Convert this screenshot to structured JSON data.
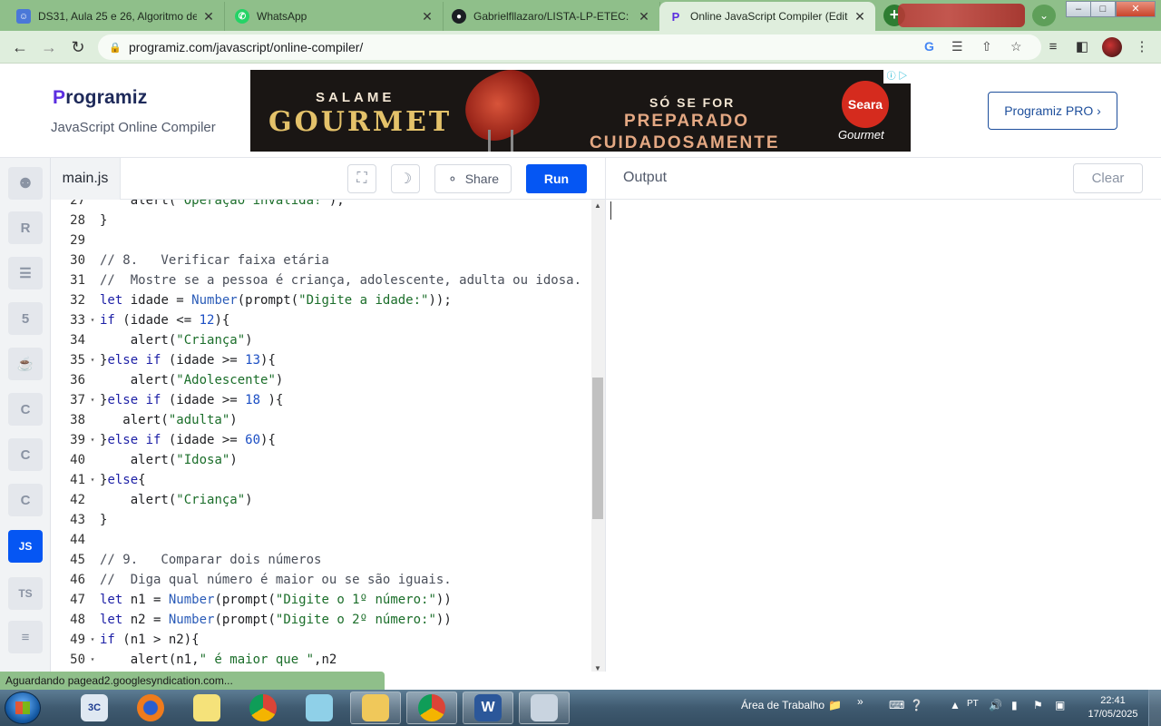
{
  "browser": {
    "tabs": [
      {
        "title": "DS31, Aula 25 e 26, Algoritmo de",
        "icon": "user-doc-icon"
      },
      {
        "title": "WhatsApp",
        "icon": "whatsapp-icon"
      },
      {
        "title": "Gabrielfllazaro/LISTA-LP-ETEC: lis",
        "icon": "github-icon"
      },
      {
        "title": "Online JavaScript Compiler (Edito",
        "icon": "programiz-icon"
      }
    ],
    "url": "programiz.com/javascript/online-compiler/"
  },
  "header": {
    "logo": "rogramiz",
    "logo_p": "P",
    "subtitle": "JavaScript Online Compiler",
    "pro_button": "Programiz PRO ›"
  },
  "ad": {
    "salame": "SALAME",
    "gourmet": "GOURMET",
    "line1": "SÓ SE FOR",
    "line2": "PREPARADO",
    "line3": "CUIDADOSAMENTE",
    "brand": "Seara",
    "brand_sub": "Gourmet"
  },
  "sidebar": {
    "items": [
      {
        "name": "python",
        "label": "⚉"
      },
      {
        "name": "r",
        "label": "R"
      },
      {
        "name": "sql",
        "label": "☰"
      },
      {
        "name": "html",
        "label": "5"
      },
      {
        "name": "java",
        "label": "☕"
      },
      {
        "name": "c",
        "label": "C"
      },
      {
        "name": "cpp",
        "label": "C"
      },
      {
        "name": "csharp",
        "label": "C"
      },
      {
        "name": "javascript",
        "label": "JS"
      },
      {
        "name": "typescript",
        "label": "TS"
      },
      {
        "name": "more",
        "label": "≡"
      }
    ]
  },
  "editor": {
    "filename": "main.js",
    "share_label": "Share",
    "run_label": "Run",
    "lines": [
      {
        "n": "27",
        "fold": false,
        "text": "    alert(\"Operação inválida!\");"
      },
      {
        "n": "28",
        "fold": false,
        "text": "}"
      },
      {
        "n": "29",
        "fold": false,
        "text": ""
      },
      {
        "n": "30",
        "fold": false,
        "text": "// 8.   Verificar faixa etária"
      },
      {
        "n": "31",
        "fold": false,
        "text": "//  Mostre se a pessoa é criança, adolescente, adulta ou idosa."
      },
      {
        "n": "32",
        "fold": false,
        "text": "let idade = Number(prompt(\"Digite a idade:\"));"
      },
      {
        "n": "33",
        "fold": true,
        "text": "if (idade <= 12){"
      },
      {
        "n": "34",
        "fold": false,
        "text": "    alert(\"Criança\")"
      },
      {
        "n": "35",
        "fold": true,
        "text": "}else if (idade >= 13){"
      },
      {
        "n": "36",
        "fold": false,
        "text": "    alert(\"Adolescente\")"
      },
      {
        "n": "37",
        "fold": true,
        "text": "}else if (idade >= 18 ){"
      },
      {
        "n": "38",
        "fold": false,
        "text": "   alert(\"adulta\")"
      },
      {
        "n": "39",
        "fold": true,
        "text": "}else if (idade >= 60){"
      },
      {
        "n": "40",
        "fold": false,
        "text": "    alert(\"Idosa\")"
      },
      {
        "n": "41",
        "fold": true,
        "text": "}else{"
      },
      {
        "n": "42",
        "fold": false,
        "text": "    alert(\"Criança\")"
      },
      {
        "n": "43",
        "fold": false,
        "text": "}"
      },
      {
        "n": "44",
        "fold": false,
        "text": ""
      },
      {
        "n": "45",
        "fold": false,
        "text": "// 9.   Comparar dois números"
      },
      {
        "n": "46",
        "fold": false,
        "text": "//  Diga qual número é maior ou se são iguais."
      },
      {
        "n": "47",
        "fold": false,
        "text": "let n1 = Number(prompt(\"Digite o 1º número:\"))"
      },
      {
        "n": "48",
        "fold": false,
        "text": "let n2 = Number(prompt(\"Digite o 2º número:\"))"
      },
      {
        "n": "49",
        "fold": true,
        "text": "if (n1 > n2){"
      },
      {
        "n": "50",
        "fold": true,
        "text": "    alert(n1,\" é maior que \",n2"
      }
    ]
  },
  "output": {
    "title": "Output",
    "clear_label": "Clear"
  },
  "status": "Aguardando pagead2.googlesyndication.com...",
  "taskbar": {
    "desktop_label": "Área de Trabalho",
    "lang": "PT",
    "time": "22:41",
    "date": "17/05/2025"
  }
}
